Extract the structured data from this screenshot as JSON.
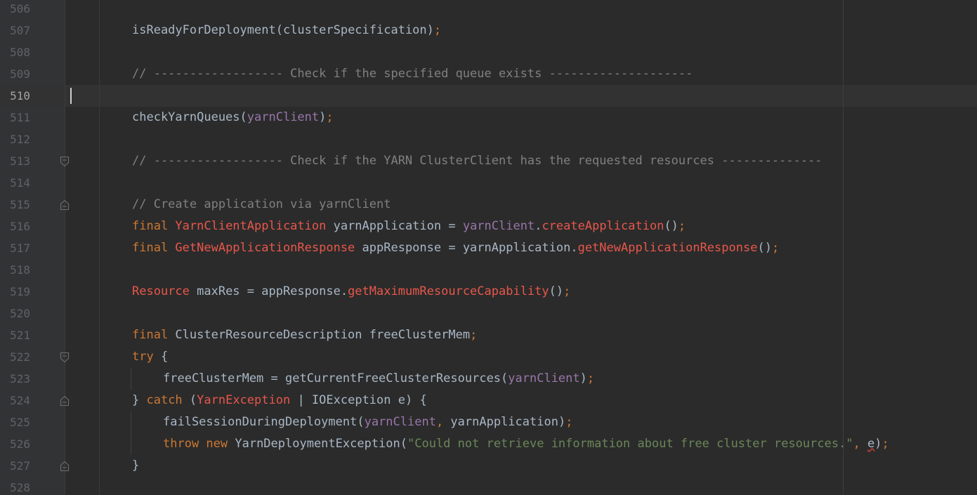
{
  "editor": {
    "current_line": "510",
    "lines": [
      {
        "num": "506",
        "indent": 0,
        "tokens": []
      },
      {
        "num": "507",
        "indent": 0,
        "tokens": [
          {
            "t": "isReadyForDeployment",
            "c": "plain"
          },
          {
            "t": "(",
            "c": "plain"
          },
          {
            "t": "clusterSpecification",
            "c": "plain"
          },
          {
            "t": ")",
            "c": "plain"
          },
          {
            "t": ";",
            "c": "punc"
          }
        ]
      },
      {
        "num": "508",
        "indent": 0,
        "tokens": []
      },
      {
        "num": "509",
        "indent": 0,
        "tokens": [
          {
            "t": "// ------------------ Check if the specified queue exists --------------------",
            "c": "cmt"
          }
        ]
      },
      {
        "num": "510",
        "indent": 0,
        "tokens": []
      },
      {
        "num": "511",
        "indent": 0,
        "tokens": [
          {
            "t": "checkYarnQueues",
            "c": "plain"
          },
          {
            "t": "(",
            "c": "plain"
          },
          {
            "t": "yarnClient",
            "c": "fld"
          },
          {
            "t": ")",
            "c": "plain"
          },
          {
            "t": ";",
            "c": "punc"
          }
        ]
      },
      {
        "num": "512",
        "indent": 0,
        "tokens": []
      },
      {
        "num": "513",
        "indent": 0,
        "fold": "start",
        "tokens": [
          {
            "t": "// ------------------ Check if the YARN ClusterClient has the requested resources --------------",
            "c": "cmt"
          }
        ]
      },
      {
        "num": "514",
        "indent": 0,
        "tokens": []
      },
      {
        "num": "515",
        "indent": 0,
        "fold": "end",
        "tokens": [
          {
            "t": "// Create application via yarnClient",
            "c": "cmt"
          }
        ]
      },
      {
        "num": "516",
        "indent": 0,
        "tokens": [
          {
            "t": "final ",
            "c": "kw"
          },
          {
            "t": "YarnClientApplication",
            "c": "cls"
          },
          {
            "t": " yarnApplication = ",
            "c": "plain"
          },
          {
            "t": "yarnClient",
            "c": "fld"
          },
          {
            "t": ".",
            "c": "plain"
          },
          {
            "t": "createApplication",
            "c": "mth"
          },
          {
            "t": "()",
            "c": "plain"
          },
          {
            "t": ";",
            "c": "punc"
          }
        ]
      },
      {
        "num": "517",
        "indent": 0,
        "tokens": [
          {
            "t": "final ",
            "c": "kw"
          },
          {
            "t": "GetNewApplicationResponse",
            "c": "cls"
          },
          {
            "t": " appResponse = yarnApplication.",
            "c": "plain"
          },
          {
            "t": "getNewApplicationResponse",
            "c": "mth"
          },
          {
            "t": "()",
            "c": "plain"
          },
          {
            "t": ";",
            "c": "punc"
          }
        ]
      },
      {
        "num": "518",
        "indent": 0,
        "tokens": []
      },
      {
        "num": "519",
        "indent": 0,
        "tokens": [
          {
            "t": "Resource",
            "c": "cls"
          },
          {
            "t": " maxRes = appResponse.",
            "c": "plain"
          },
          {
            "t": "getMaximumResourceCapability",
            "c": "mth"
          },
          {
            "t": "()",
            "c": "plain"
          },
          {
            "t": ";",
            "c": "punc"
          }
        ]
      },
      {
        "num": "520",
        "indent": 0,
        "tokens": []
      },
      {
        "num": "521",
        "indent": 0,
        "tokens": [
          {
            "t": "final ",
            "c": "kw"
          },
          {
            "t": "ClusterResourceDescription freeClusterMem",
            "c": "plain"
          },
          {
            "t": ";",
            "c": "punc"
          }
        ]
      },
      {
        "num": "522",
        "indent": 0,
        "fold": "start",
        "tokens": [
          {
            "t": "try",
            "c": "kw"
          },
          {
            "t": " {",
            "c": "plain"
          }
        ]
      },
      {
        "num": "523",
        "indent": 1,
        "tokens": [
          {
            "t": "freeClusterMem = getCurrentFreeClusterResources(",
            "c": "plain"
          },
          {
            "t": "yarnClient",
            "c": "fld"
          },
          {
            "t": ")",
            "c": "plain"
          },
          {
            "t": ";",
            "c": "punc"
          }
        ]
      },
      {
        "num": "524",
        "indent": 0,
        "fold": "end",
        "tokens": [
          {
            "t": "} ",
            "c": "plain"
          },
          {
            "t": "catch",
            "c": "kw"
          },
          {
            "t": " (",
            "c": "plain"
          },
          {
            "t": "YarnException",
            "c": "cls"
          },
          {
            "t": " | IOException e) {",
            "c": "plain"
          }
        ]
      },
      {
        "num": "525",
        "indent": 1,
        "tokens": [
          {
            "t": "failSessionDuringDeployment(",
            "c": "plain"
          },
          {
            "t": "yarnClient",
            "c": "fld"
          },
          {
            "t": ", ",
            "c": "punc"
          },
          {
            "t": "yarnApplication)",
            "c": "plain"
          },
          {
            "t": ";",
            "c": "punc"
          }
        ]
      },
      {
        "num": "526",
        "indent": 1,
        "tokens": [
          {
            "t": "throw new ",
            "c": "kw"
          },
          {
            "t": "YarnDeploymentException(",
            "c": "plain"
          },
          {
            "t": "\"Could not retrieve information about free cluster resources.\"",
            "c": "str"
          },
          {
            "t": ", ",
            "c": "punc"
          },
          {
            "t": "e",
            "c": "plain err"
          },
          {
            "t": ")",
            "c": "plain"
          },
          {
            "t": ";",
            "c": "punc"
          }
        ]
      },
      {
        "num": "527",
        "indent": 0,
        "fold": "end",
        "tokens": [
          {
            "t": "}",
            "c": "plain"
          }
        ]
      },
      {
        "num": "528",
        "indent": 0,
        "tokens": []
      }
    ]
  }
}
